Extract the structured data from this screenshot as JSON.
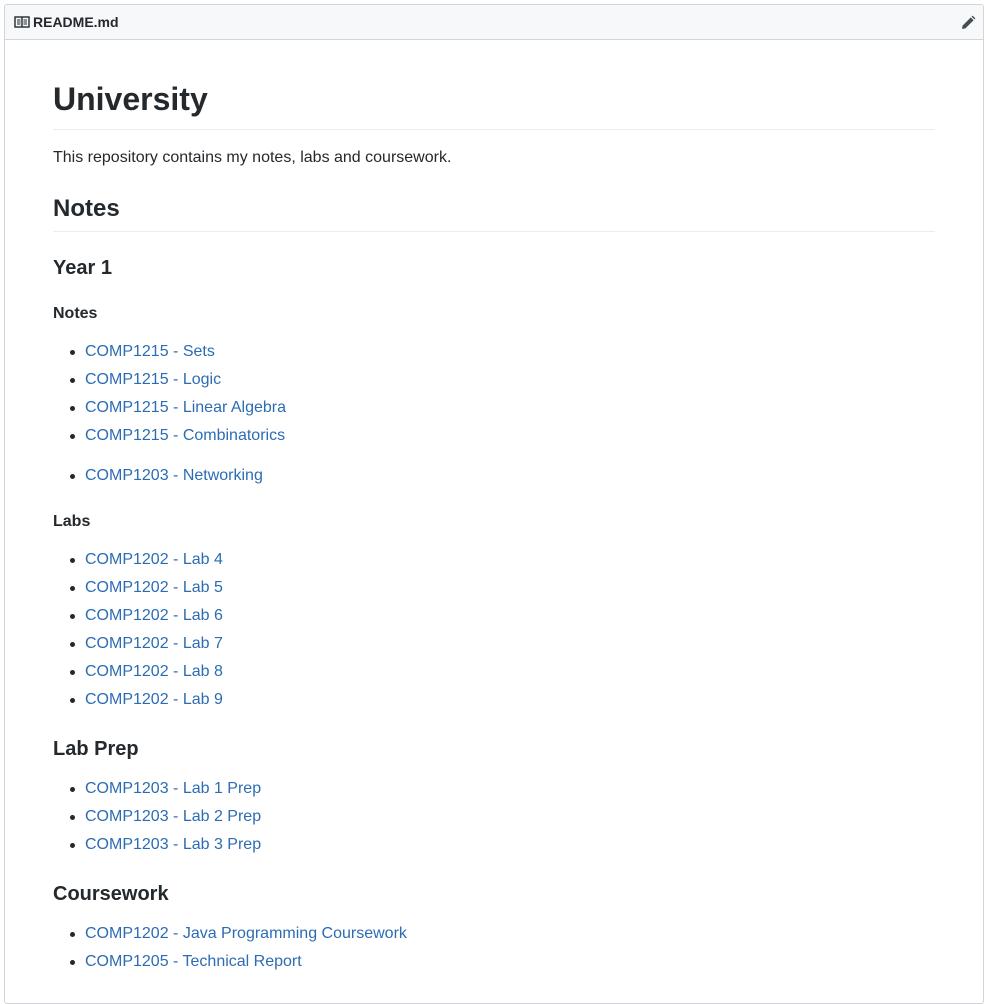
{
  "header": {
    "filename": "README.md",
    "book_icon": "book-icon",
    "edit_icon": "pencil-icon"
  },
  "content": {
    "title": "University",
    "intro": "This repository contains my notes, labs and coursework.",
    "notes_heading": "Notes",
    "year1_heading": "Year 1",
    "year1_notes_heading": "Notes",
    "notes_group1": [
      "COMP1215 - Sets",
      "COMP1215 - Logic",
      "COMP1215 - Linear Algebra",
      "COMP1215 - Combinatorics"
    ],
    "notes_group2": [
      "COMP1203 - Networking"
    ],
    "labs_heading": "Labs",
    "labs": [
      "COMP1202 - Lab 4",
      "COMP1202 - Lab 5",
      "COMP1202 - Lab 6",
      "COMP1202 - Lab 7",
      "COMP1202 - Lab 8",
      "COMP1202 - Lab 9"
    ],
    "lab_prep_heading": "Lab Prep",
    "lab_prep": [
      "COMP1203 - Lab 1 Prep",
      "COMP1203 - Lab 2 Prep",
      "COMP1203 - Lab 3 Prep"
    ],
    "coursework_heading": "Coursework",
    "coursework": [
      "COMP1202 - Java Programming Coursework",
      "COMP1205 - Technical Report"
    ]
  },
  "colors": {
    "link": "#2b6cb3",
    "text": "#24292e",
    "border": "#d1d5da",
    "header_bg": "#f6f8fa"
  }
}
